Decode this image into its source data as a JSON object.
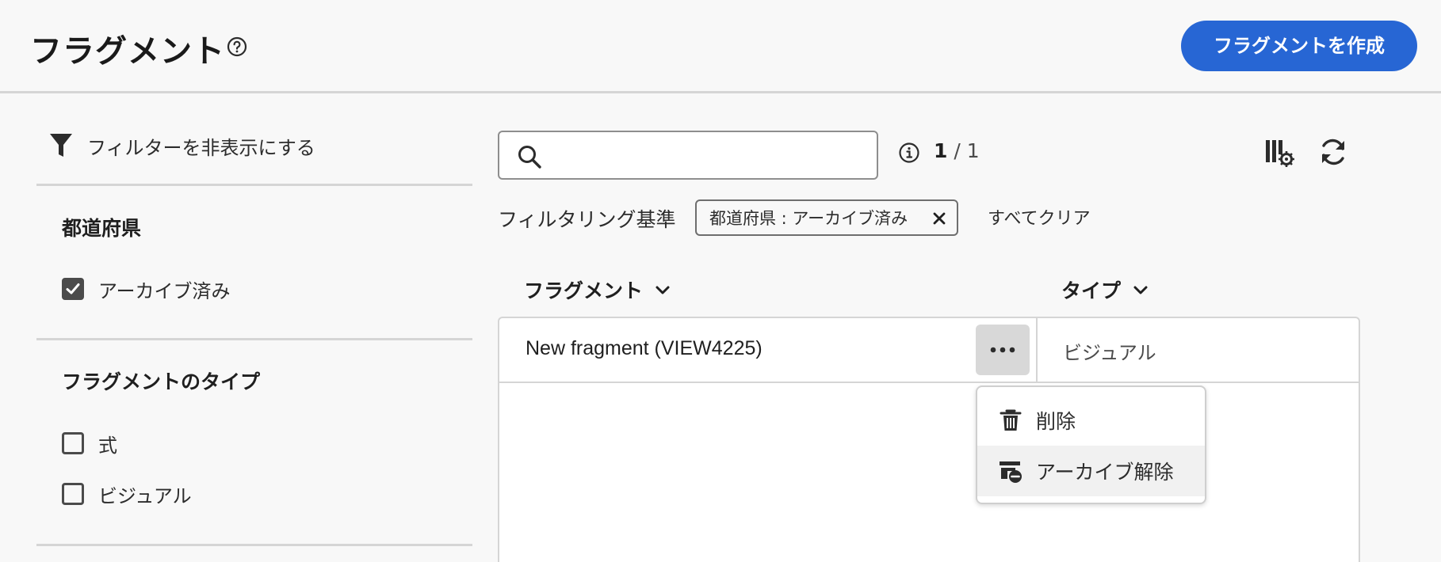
{
  "header": {
    "title": "フラグメント",
    "create_label": "フラグメントを作成"
  },
  "filters": {
    "toggle_label": "フィルターを非表示にする",
    "sections": [
      {
        "title": "都道府県",
        "options": [
          {
            "label": "アーカイブ済み",
            "checked": true
          }
        ]
      },
      {
        "title": "フラグメントのタイプ",
        "options": [
          {
            "label": "式",
            "checked": false
          },
          {
            "label": "ビジュアル",
            "checked": false
          }
        ]
      }
    ]
  },
  "search": {
    "placeholder": "",
    "value": ""
  },
  "results": {
    "current": "1",
    "separator": "/",
    "total": "1"
  },
  "active_filters": {
    "label": "フィルタリング基準",
    "chips": [
      "都道府県 : アーカイブ済み"
    ],
    "clear_all": "すべてクリア"
  },
  "table": {
    "headers": [
      "フラグメント",
      "タイプ"
    ],
    "rows": [
      {
        "name": "New fragment (VIEW4225)",
        "type": "ビジュアル"
      }
    ]
  },
  "menu": {
    "items": [
      {
        "label": "削除",
        "icon": "trash-icon"
      },
      {
        "label": "アーカイブ解除",
        "icon": "unarchive-icon"
      }
    ]
  },
  "colors": {
    "accent": "#2766d4",
    "background": "#f8f8f8",
    "checkbox": "#4b4b4b"
  }
}
